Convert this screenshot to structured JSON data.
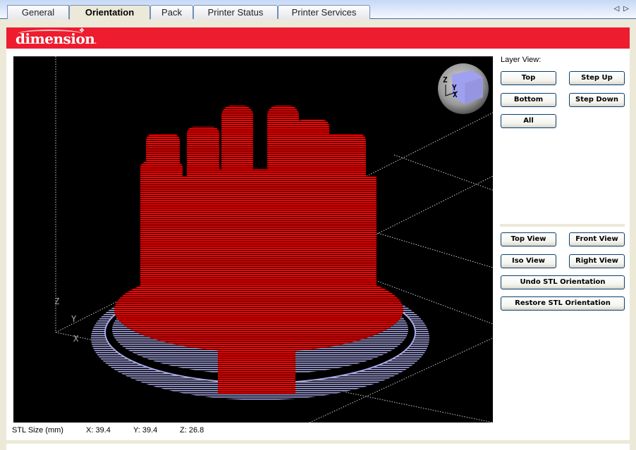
{
  "tabs": [
    {
      "label": "General",
      "active": false
    },
    {
      "label": "Orientation",
      "active": true
    },
    {
      "label": "Pack",
      "active": false
    },
    {
      "label": "Printer Status",
      "active": false
    },
    {
      "label": "Printer Services",
      "active": false
    }
  ],
  "tab_scroll": {
    "left": "◁",
    "right": "▷"
  },
  "brand": {
    "logo_text": "dimension",
    "logo_suffix": ".",
    "color": "#ed1c2e"
  },
  "viewport": {
    "background": "#000000",
    "part_color": "#ff0000",
    "support_color": "#a9a9e6",
    "axis_labels": {
      "z": "Z",
      "y": "Y",
      "x": "X"
    },
    "orientation_cube": {
      "z": "Z",
      "y": "Y",
      "x": "X"
    }
  },
  "layer_view": {
    "title": "Layer View:",
    "buttons": {
      "top": "Top",
      "step_up": "Step Up",
      "bottom": "Bottom",
      "step_down": "Step Down",
      "all": "All"
    }
  },
  "view_controls": {
    "top_view": "Top View",
    "front_view": "Front View",
    "iso_view": "Iso View",
    "right_view": "Right View",
    "undo": "Undo STL Orientation",
    "restore": "Restore STL Orientation"
  },
  "stl_size": {
    "label": "STL Size (mm)",
    "x": "X:  39.4",
    "y": "Y:  39.4",
    "z": "Z:  26.8"
  }
}
